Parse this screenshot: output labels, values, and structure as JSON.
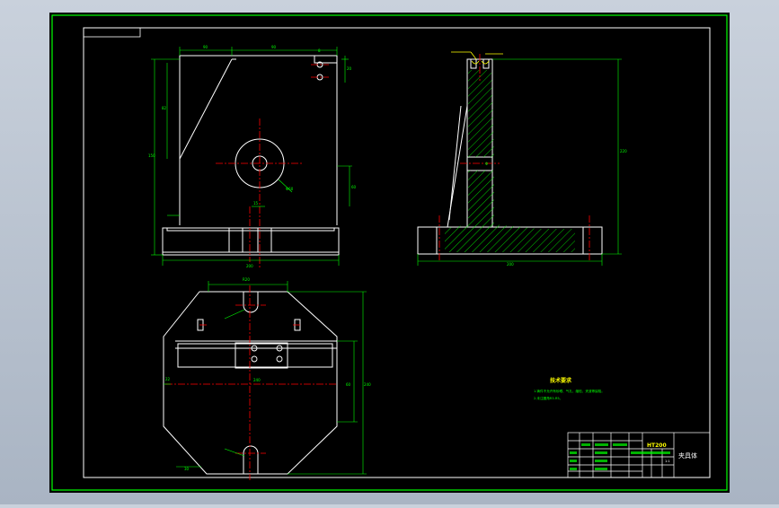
{
  "drawing": {
    "colors": {
      "background_outer": "#b8c2cf",
      "sheet": "#000000",
      "frame": "#00ff00",
      "outline": "#ffffff",
      "center_line": "#ff0000",
      "dimension": "#00ff00",
      "annotation": "#ffff00",
      "hatch": "#00ff00"
    },
    "notes": {
      "title": "技术要求",
      "line1": "1.铸件不允许有砂眼、气孔、缩松、夹渣等缺陷。",
      "line2": "2.未注圆角R3-R5。"
    },
    "title_block": {
      "material": "HT200",
      "part_name": "夹具体",
      "scale": "1:1"
    }
  }
}
